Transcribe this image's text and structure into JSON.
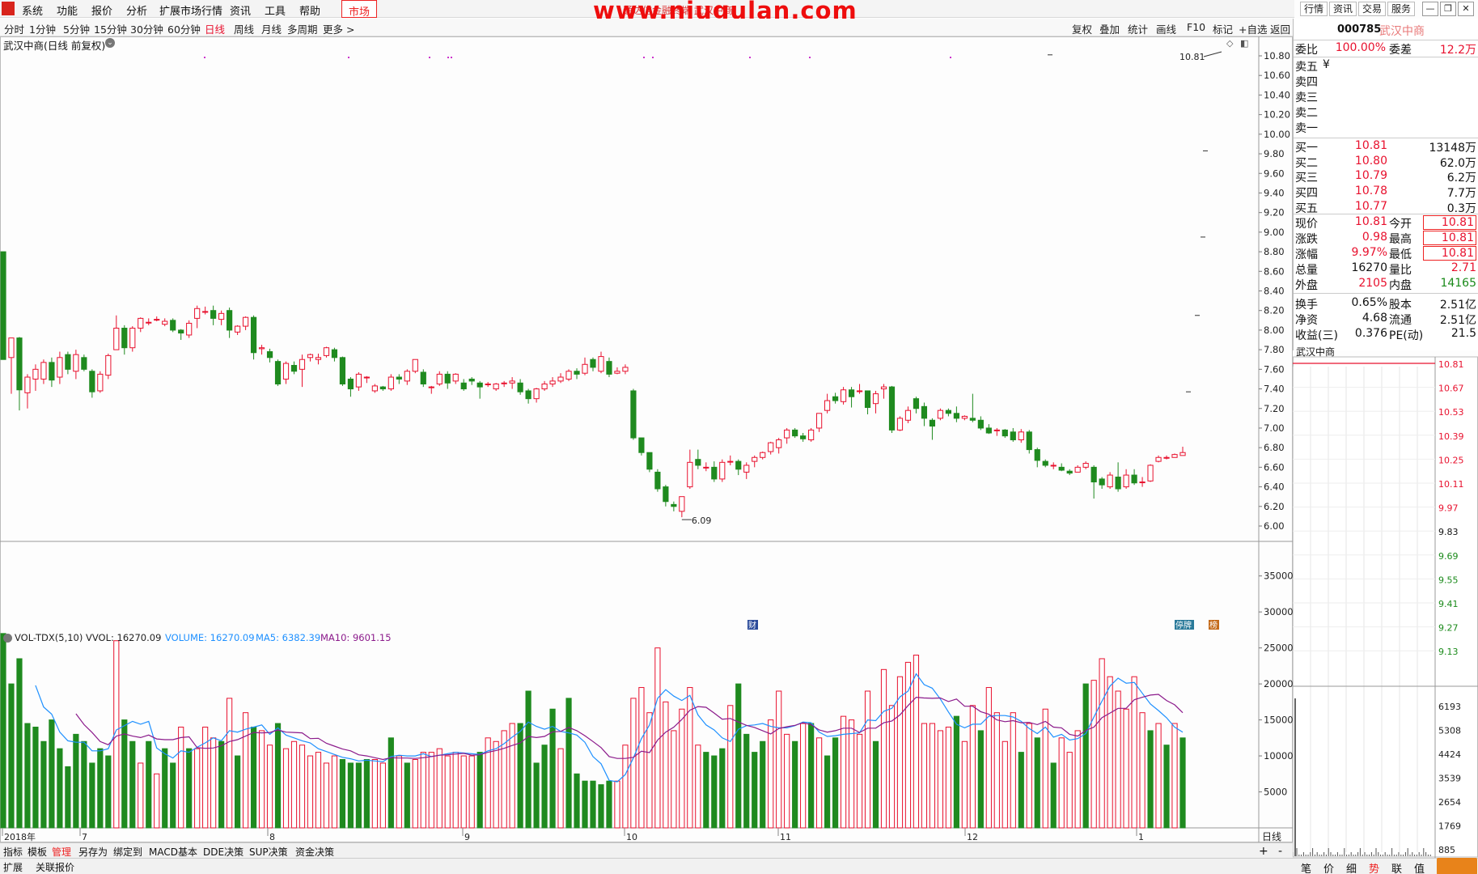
{
  "watermark": "www.niugulan.com",
  "title_overlay": "通达信金融终端 武汉中商",
  "menu": [
    "系统",
    "功能",
    "报价",
    "分析",
    "扩展市场行情",
    "资讯",
    "工具",
    "帮助",
    "市场"
  ],
  "right_tabs": [
    "行情",
    "资讯",
    "交易",
    "服务"
  ],
  "periods": [
    "分时",
    "1分钟",
    "5分钟",
    "15分钟",
    "30分钟",
    "60分钟",
    "日线",
    "周线",
    "月线",
    "多周期",
    "更多 >"
  ],
  "active_period": "日线",
  "toolbar_right": [
    "复权",
    "叠加",
    "统计",
    "画线",
    "F10",
    "标记",
    "+自选",
    "返回"
  ],
  "chart_title": "武汉中商(日线 前复权)",
  "vol_label": "VOL-TDX(5,10)",
  "vol_vvol": "VVOL: 16270.09",
  "vol_volume": "VOLUME: 16270.09",
  "vol_ma5": "MA5: 6382.39",
  "vol_ma10": "MA10: 9601.15",
  "price_axis": [
    "10.80",
    "10.60",
    "10.40",
    "10.20",
    "10.00",
    "9.80",
    "9.60",
    "9.40",
    "9.20",
    "9.00",
    "8.80",
    "8.60",
    "8.40",
    "8.20",
    "8.00",
    "7.80",
    "7.60",
    "7.40",
    "7.20",
    "7.00",
    "6.80",
    "6.60",
    "6.40",
    "6.20",
    "6.00"
  ],
  "vol_axis": [
    "35000",
    "30000",
    "25000",
    "20000",
    "15000",
    "10000",
    "5000"
  ],
  "xaxis_labels": [
    "2018年",
    "7",
    "8",
    "9",
    "10",
    "11",
    "12",
    "1"
  ],
  "xaxis_right": "日线",
  "annotations": {
    "high": "10.81",
    "low": "6.09",
    "cai": "财",
    "tingpai": "停牌",
    "bang": "榜"
  },
  "colors": {
    "up": "#e8112e",
    "down": "#1f8a1f",
    "ma5": "#1e90ff",
    "ma10": "#8b1a8b",
    "bg": "#fdfdfd"
  },
  "quote": {
    "code": "000785",
    "name": "武汉中商",
    "weibi_label": "委比",
    "weibi": "100.00%",
    "weicha_label": "委差",
    "weicha": "12.2万",
    "sell": [
      [
        "卖五",
        "¥"
      ],
      [
        "卖四",
        ""
      ],
      [
        "卖三",
        ""
      ],
      [
        "卖二",
        ""
      ],
      [
        "卖一",
        ""
      ]
    ],
    "buy": [
      [
        "买一",
        "10.81",
        "13148万"
      ],
      [
        "买二",
        "10.80",
        "62.0万"
      ],
      [
        "买三",
        "10.79",
        "6.2万"
      ],
      [
        "买四",
        "10.78",
        "7.7万"
      ],
      [
        "买五",
        "10.77",
        "0.3万"
      ]
    ],
    "stats": [
      [
        "现价",
        "10.81",
        "今开",
        "10.81"
      ],
      [
        "涨跌",
        "0.98",
        "最高",
        "10.81"
      ],
      [
        "涨幅",
        "9.97%",
        "最低",
        "10.81"
      ],
      [
        "总量",
        "16270",
        "量比",
        "2.71"
      ],
      [
        "外盘",
        "2105",
        "内盘",
        "14165"
      ],
      [
        "换手",
        "0.65%",
        "股本",
        "2.51亿"
      ],
      [
        "净资",
        "4.68",
        "流通",
        "2.51亿"
      ],
      [
        "收益(三)",
        "0.376",
        "PE(动)",
        "21.5"
      ]
    ]
  },
  "intraday": {
    "title": "武汉中商",
    "price_labels": [
      "10.81",
      "10.67",
      "10.53",
      "10.39",
      "10.25",
      "10.11",
      "9.97",
      "9.83",
      "9.69",
      "9.55",
      "9.41",
      "9.27",
      "9.13"
    ],
    "vol_labels": [
      "6193",
      "5308",
      "4424",
      "3539",
      "2654",
      "1769",
      "885"
    ]
  },
  "bottom_tabs": [
    "指标",
    "模板",
    "管理",
    "另存为",
    "绑定到",
    "MACD基本",
    "DDE决策",
    "SUP决策",
    "资金决策"
  ],
  "bottom_tabs2": [
    "扩展",
    "关联报价"
  ],
  "bottom_right": [
    "笔",
    "价",
    "细",
    "势",
    "联",
    "值"
  ],
  "bottom_right_active": "势",
  "nav_icons": [
    "plus-icon",
    "minus-icon"
  ],
  "candles": [
    [
      8.8,
      7.7,
      7.75,
      8.33
    ],
    [
      7.72,
      7.92,
      7.35,
      7.92
    ],
    [
      7.92,
      7.39,
      7.18,
      7.93
    ],
    [
      7.36,
      7.52,
      7.2,
      7.55
    ],
    [
      7.5,
      7.6,
      7.38,
      7.65
    ],
    [
      7.5,
      7.67,
      7.45,
      7.7
    ],
    [
      7.67,
      7.49,
      7.42,
      7.72
    ],
    [
      7.52,
      7.72,
      7.45,
      7.78
    ],
    [
      7.75,
      7.6,
      7.55,
      7.78
    ],
    [
      7.58,
      7.75,
      7.5,
      7.8
    ],
    [
      7.72,
      7.6,
      7.58,
      7.75
    ],
    [
      7.58,
      7.37,
      7.31,
      7.6
    ],
    [
      7.38,
      7.55,
      7.36,
      7.58
    ],
    [
      7.54,
      7.74,
      7.5,
      7.76
    ],
    [
      7.8,
      8.02,
      7.82,
      8.15
    ],
    [
      8.02,
      7.82,
      7.75,
      8.05
    ],
    [
      7.82,
      8.02,
      7.78,
      8.04
    ],
    [
      8.02,
      8.12,
      7.98,
      8.13
    ],
    [
      8.08,
      8.08,
      8.05,
      8.12
    ],
    [
      8.11,
      8.11,
      8.09,
      8.14
    ],
    [
      8.06,
      8.09,
      8.04,
      8.12
    ],
    [
      8.1,
      8.0,
      7.98,
      8.12
    ],
    [
      8.0,
      7.97,
      7.9,
      8.01
    ],
    [
      7.95,
      8.07,
      7.92,
      8.1
    ],
    [
      8.12,
      8.22,
      8.02,
      8.25
    ],
    [
      8.19,
      8.19,
      8.16,
      8.24
    ],
    [
      8.2,
      8.12,
      8.05,
      8.25
    ],
    [
      8.11,
      8.17,
      8.05,
      8.2
    ],
    [
      8.2,
      8.0,
      7.92,
      8.23
    ],
    [
      7.98,
      8.04,
      7.95,
      8.05
    ],
    [
      8.04,
      8.13,
      8.0,
      8.14
    ],
    [
      8.13,
      7.77,
      7.7,
      8.15
    ],
    [
      7.81,
      7.82,
      7.75,
      7.85
    ],
    [
      7.78,
      7.72,
      7.67,
      7.81
    ],
    [
      7.68,
      7.45,
      7.43,
      7.7
    ],
    [
      7.5,
      7.66,
      7.45,
      7.68
    ],
    [
      7.64,
      7.58,
      7.55,
      7.68
    ],
    [
      7.6,
      7.7,
      7.42,
      7.75
    ],
    [
      7.72,
      7.75,
      7.68,
      7.76
    ],
    [
      7.7,
      7.72,
      7.65,
      7.76
    ],
    [
      7.74,
      7.82,
      7.72,
      7.83
    ],
    [
      7.8,
      7.72,
      7.68,
      7.82
    ],
    [
      7.72,
      7.45,
      7.43,
      7.73
    ],
    [
      7.5,
      7.4,
      7.32,
      7.52
    ],
    [
      7.42,
      7.55,
      7.38,
      7.57
    ],
    [
      7.52,
      7.52,
      7.46,
      7.53
    ],
    [
      7.38,
      7.43,
      7.36,
      7.45
    ],
    [
      7.42,
      7.4,
      7.38,
      7.43
    ],
    [
      7.4,
      7.52,
      7.38,
      7.55
    ],
    [
      7.52,
      7.5,
      7.45,
      7.55
    ],
    [
      7.48,
      7.58,
      7.44,
      7.6
    ],
    [
      7.58,
      7.7,
      7.56,
      7.7
    ],
    [
      7.57,
      7.45,
      7.42,
      7.6
    ],
    [
      7.42,
      7.42,
      7.35,
      7.43
    ],
    [
      7.45,
      7.55,
      7.43,
      7.58
    ],
    [
      7.55,
      7.46,
      7.4,
      7.58
    ],
    [
      7.48,
      7.55,
      7.45,
      7.56
    ],
    [
      7.46,
      7.4,
      7.38,
      7.5
    ],
    [
      7.5,
      7.48,
      7.44,
      7.52
    ],
    [
      7.46,
      7.42,
      7.3,
      7.48
    ],
    [
      7.45,
      7.45,
      7.42,
      7.47
    ],
    [
      7.4,
      7.45,
      7.38,
      7.46
    ],
    [
      7.46,
      7.46,
      7.42,
      7.48
    ],
    [
      7.46,
      7.48,
      7.4,
      7.52
    ],
    [
      7.46,
      7.37,
      7.34,
      7.5
    ],
    [
      7.38,
      7.3,
      7.25,
      7.4
    ],
    [
      7.3,
      7.4,
      7.26,
      7.41
    ],
    [
      7.4,
      7.45,
      7.38,
      7.48
    ],
    [
      7.45,
      7.48,
      7.42,
      7.52
    ],
    [
      7.48,
      7.52,
      7.46,
      7.56
    ],
    [
      7.5,
      7.58,
      7.48,
      7.6
    ],
    [
      7.58,
      7.55,
      7.5,
      7.61
    ],
    [
      7.56,
      7.65,
      7.54,
      7.72
    ],
    [
      7.7,
      7.62,
      7.58,
      7.72
    ],
    [
      7.58,
      7.73,
      7.56,
      7.78
    ],
    [
      7.68,
      7.55,
      7.52,
      7.72
    ],
    [
      7.56,
      7.58,
      7.55,
      7.62
    ],
    [
      7.58,
      7.62,
      7.55,
      7.65
    ],
    [
      7.38,
      6.9,
      6.88,
      7.4
    ],
    [
      6.9,
      6.75,
      6.72,
      6.9
    ],
    [
      6.75,
      6.58,
      6.55,
      6.75
    ],
    [
      6.55,
      6.38,
      6.35,
      6.58
    ],
    [
      6.4,
      6.25,
      6.2,
      6.42
    ],
    [
      6.22,
      6.2,
      6.15,
      6.25
    ],
    [
      6.15,
      6.3,
      6.09,
      6.3
    ],
    [
      6.4,
      6.65,
      6.38,
      6.78
    ],
    [
      6.68,
      6.62,
      6.58,
      6.78
    ],
    [
      6.6,
      6.6,
      6.56,
      6.65
    ],
    [
      6.6,
      6.48,
      6.45,
      6.66
    ],
    [
      6.48,
      6.65,
      6.45,
      6.68
    ],
    [
      6.66,
      6.66,
      6.62,
      6.72
    ],
    [
      6.66,
      6.58,
      6.52,
      6.68
    ],
    [
      6.55,
      6.62,
      6.48,
      6.65
    ],
    [
      6.66,
      6.7,
      6.6,
      6.72
    ],
    [
      6.7,
      6.75,
      6.68,
      6.76
    ],
    [
      6.76,
      6.85,
      6.73,
      6.86
    ],
    [
      6.8,
      6.88,
      6.74,
      6.9
    ],
    [
      6.9,
      6.98,
      6.84,
      7.0
    ],
    [
      6.98,
      6.92,
      6.9,
      7.0
    ],
    [
      6.92,
      6.89,
      6.86,
      6.95
    ],
    [
      6.88,
      6.98,
      6.86,
      7.0
    ],
    [
      7.0,
      7.15,
      6.96,
      7.15
    ],
    [
      7.18,
      7.28,
      7.15,
      7.35
    ],
    [
      7.32,
      7.28,
      7.25,
      7.36
    ],
    [
      7.27,
      7.39,
      7.24,
      7.42
    ],
    [
      7.39,
      7.32,
      7.21,
      7.42
    ],
    [
      7.38,
      7.38,
      7.35,
      7.45
    ],
    [
      7.38,
      7.21,
      7.14,
      7.38
    ],
    [
      7.25,
      7.35,
      7.15,
      7.38
    ],
    [
      7.4,
      7.42,
      7.3,
      7.45
    ],
    [
      7.42,
      6.98,
      6.95,
      7.43
    ],
    [
      6.98,
      7.1,
      6.97,
      7.12
    ],
    [
      7.08,
      7.18,
      7.05,
      7.22
    ],
    [
      7.3,
      7.2,
      7.15,
      7.32
    ],
    [
      7.22,
      7.1,
      7.02,
      7.26
    ],
    [
      7.08,
      7.02,
      6.88,
      7.1
    ],
    [
      7.1,
      7.18,
      7.08,
      7.2
    ],
    [
      7.18,
      7.15,
      7.12,
      7.2
    ],
    [
      7.15,
      7.1,
      7.06,
      7.22
    ],
    [
      7.1,
      7.12,
      7.08,
      7.13
    ],
    [
      7.1,
      7.08,
      7.06,
      7.35
    ],
    [
      7.08,
      7.0,
      6.98,
      7.12
    ],
    [
      7.0,
      6.95,
      6.94,
      7.04
    ],
    [
      6.98,
      6.98,
      6.92,
      7.0
    ],
    [
      6.98,
      6.92,
      6.9,
      6.99
    ],
    [
      6.96,
      6.88,
      6.86,
      7.0
    ],
    [
      6.88,
      6.96,
      6.85,
      6.99
    ],
    [
      6.96,
      6.78,
      6.74,
      6.98
    ],
    [
      6.78,
      6.67,
      6.6,
      6.8
    ],
    [
      6.66,
      6.62,
      6.6,
      6.68
    ],
    [
      6.62,
      6.62,
      6.58,
      6.65
    ],
    [
      6.6,
      6.57,
      6.56,
      6.64
    ],
    [
      6.56,
      6.54,
      6.52,
      6.58
    ],
    [
      6.55,
      6.6,
      6.55,
      6.62
    ],
    [
      6.6,
      6.64,
      6.58,
      6.66
    ],
    [
      6.6,
      6.45,
      6.28,
      6.62
    ],
    [
      6.48,
      6.42,
      6.38,
      6.5
    ],
    [
      6.4,
      6.52,
      6.38,
      6.55
    ],
    [
      6.5,
      6.38,
      6.35,
      6.65
    ],
    [
      6.4,
      6.52,
      6.38,
      6.58
    ],
    [
      6.52,
      6.44,
      6.42,
      6.58
    ],
    [
      6.45,
      6.45,
      6.4,
      6.5
    ],
    [
      6.46,
      6.62,
      6.45,
      6.63
    ],
    [
      6.66,
      6.7,
      6.65,
      6.72
    ],
    [
      6.7,
      6.7,
      6.68,
      6.72
    ],
    [
      6.7,
      6.73,
      6.7,
      6.74
    ],
    [
      6.72,
      6.75,
      6.72,
      6.81
    ]
  ],
  "volumes": [
    [
      27000,
      0
    ],
    [
      20000,
      0
    ],
    [
      23500,
      0
    ],
    [
      14500,
      0
    ],
    [
      14000,
      0
    ],
    [
      12000,
      0
    ],
    [
      15000,
      0
    ],
    [
      11000,
      0
    ],
    [
      8500,
      0
    ],
    [
      13000,
      0
    ],
    [
      12000,
      0
    ],
    [
      9000,
      0
    ],
    [
      11000,
      0
    ],
    [
      10000,
      0
    ],
    [
      26000,
      1
    ],
    [
      15000,
      0
    ],
    [
      12000,
      0
    ],
    [
      9000,
      1
    ],
    [
      12000,
      0
    ],
    [
      7500,
      1
    ],
    [
      11000,
      0
    ],
    [
      9000,
      0
    ],
    [
      14000,
      1
    ],
    [
      11000,
      0
    ],
    [
      11000,
      1
    ],
    [
      14000,
      1
    ],
    [
      12500,
      1
    ],
    [
      12000,
      0
    ],
    [
      18000,
      1
    ],
    [
      10000,
      0
    ],
    [
      16000,
      1
    ],
    [
      14000,
      0
    ],
    [
      13500,
      1
    ],
    [
      11500,
      1
    ],
    [
      14500,
      0
    ],
    [
      11000,
      1
    ],
    [
      12000,
      1
    ],
    [
      11500,
      1
    ],
    [
      10000,
      1
    ],
    [
      10500,
      1
    ],
    [
      9000,
      1
    ],
    [
      10000,
      1
    ],
    [
      9500,
      0
    ],
    [
      9000,
      0
    ],
    [
      9000,
      0
    ],
    [
      9500,
      0
    ],
    [
      9500,
      1
    ],
    [
      9000,
      1
    ],
    [
      12500,
      0
    ],
    [
      10000,
      1
    ],
    [
      9000,
      0
    ],
    [
      9500,
      1
    ],
    [
      10500,
      1
    ],
    [
      10500,
      1
    ],
    [
      11000,
      1
    ],
    [
      10000,
      1
    ],
    [
      10500,
      1
    ],
    [
      10000,
      1
    ],
    [
      10000,
      1
    ],
    [
      10500,
      0
    ],
    [
      12500,
      1
    ],
    [
      12000,
      1
    ],
    [
      13500,
      1
    ],
    [
      14500,
      1
    ],
    [
      14500,
      0
    ],
    [
      19000,
      0
    ],
    [
      9000,
      0
    ],
    [
      11500,
      0
    ],
    [
      16500,
      0
    ],
    [
      11000,
      1
    ],
    [
      18000,
      0
    ],
    [
      7500,
      0
    ],
    [
      6500,
      0
    ],
    [
      6500,
      0
    ],
    [
      6000,
      0
    ],
    [
      6500,
      0
    ],
    [
      6500,
      1
    ],
    [
      11500,
      1
    ],
    [
      18000,
      1
    ],
    [
      19500,
      1
    ],
    [
      16000,
      1
    ],
    [
      25000,
      1
    ],
    [
      17500,
      1
    ],
    [
      13500,
      1
    ],
    [
      16500,
      1
    ],
    [
      19500,
      1
    ],
    [
      11500,
      1
    ],
    [
      10500,
      0
    ],
    [
      10000,
      0
    ],
    [
      11000,
      0
    ],
    [
      17000,
      1
    ],
    [
      20000,
      0
    ],
    [
      13000,
      0
    ],
    [
      10500,
      0
    ],
    [
      12000,
      0
    ],
    [
      15000,
      1
    ],
    [
      19000,
      1
    ],
    [
      13000,
      1
    ],
    [
      12000,
      0
    ],
    [
      14500,
      1
    ],
    [
      14500,
      0
    ],
    [
      12500,
      1
    ],
    [
      10000,
      0
    ],
    [
      12500,
      0
    ],
    [
      15500,
      1
    ],
    [
      15000,
      1
    ],
    [
      13000,
      1
    ],
    [
      19000,
      1
    ],
    [
      12000,
      0
    ],
    [
      22000,
      1
    ],
    [
      17000,
      1
    ],
    [
      21000,
      1
    ],
    [
      23000,
      1
    ],
    [
      24000,
      1
    ],
    [
      14500,
      1
    ],
    [
      14500,
      1
    ],
    [
      13500,
      1
    ],
    [
      14000,
      1
    ],
    [
      15500,
      0
    ],
    [
      12000,
      1
    ],
    [
      17000,
      1
    ],
    [
      13500,
      0
    ],
    [
      19500,
      1
    ],
    [
      16000,
      1
    ],
    [
      12000,
      1
    ],
    [
      16000,
      1
    ],
    [
      10500,
      0
    ],
    [
      14500,
      1
    ],
    [
      12500,
      0
    ],
    [
      16500,
      1
    ],
    [
      9000,
      0
    ],
    [
      12500,
      1
    ],
    [
      10500,
      1
    ],
    [
      13500,
      1
    ],
    [
      20000,
      0
    ],
    [
      20500,
      1
    ],
    [
      23500,
      1
    ],
    [
      21000,
      1
    ],
    [
      19000,
      1
    ],
    [
      16500,
      1
    ],
    [
      21000,
      1
    ],
    [
      16000,
      1
    ],
    [
      13500,
      0
    ],
    [
      14500,
      1
    ],
    [
      11500,
      0
    ],
    [
      14500,
      1
    ],
    [
      12500,
      0
    ],
    [
      8500,
      0
    ],
    [
      12500,
      1
    ],
    [
      10500,
      0
    ],
    [
      8000,
      0
    ],
    [
      9500,
      1
    ],
    [
      10000,
      1
    ],
    [
      10500,
      1
    ],
    [
      8000,
      1
    ]
  ]
}
